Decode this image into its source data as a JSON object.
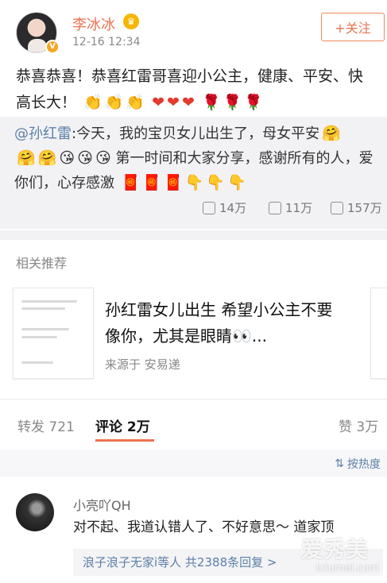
{
  "post": {
    "username": "李冰冰",
    "time": "12-16 12:34",
    "follow_label": "+关注",
    "text": "恭喜恭喜！恭喜红雷哥喜迎小公主，健康、平安、快高长大！",
    "emojis": [
      "👏",
      "👏",
      "👏",
      "❤",
      "❤",
      "❤",
      "🌹",
      "🌹",
      "🌹"
    ]
  },
  "repost": {
    "mention": "@孙红雷",
    "text": ":今天，我的宝贝女儿出生了，母女平安",
    "text2": "第一时间和大家分享，感谢所有的人，爱你们，心存感激",
    "emojis_a": [
      "🤗"
    ],
    "emojis_b": [
      "🤗",
      "🤗",
      "😘",
      "😘",
      "😘"
    ],
    "emojis_c": [
      "🧧",
      "🧧",
      "🧧",
      "👇",
      "👇",
      "👇"
    ],
    "stats": {
      "repost": "14万",
      "comment": "11万",
      "like": "157万"
    }
  },
  "recommend": {
    "title": "相关推荐",
    "headline": "孙红雷女儿出生 希望小公主不要像你，尤其是眼睛👀...",
    "source": "来源于 安易递"
  },
  "tabs": {
    "repost": "转发 721",
    "comment": "评论 2万",
    "like": "赞 3万"
  },
  "sort": {
    "label": "按热度"
  },
  "comment": {
    "name": "小亮吖QH",
    "text": "对不起、我道认错人了、不好意思～ 道家顶",
    "replies": "浪子浪子无家i等人  共2388条回复 >"
  },
  "watermark": {
    "big": "爱秀美",
    "small": "ixiumei.com"
  }
}
